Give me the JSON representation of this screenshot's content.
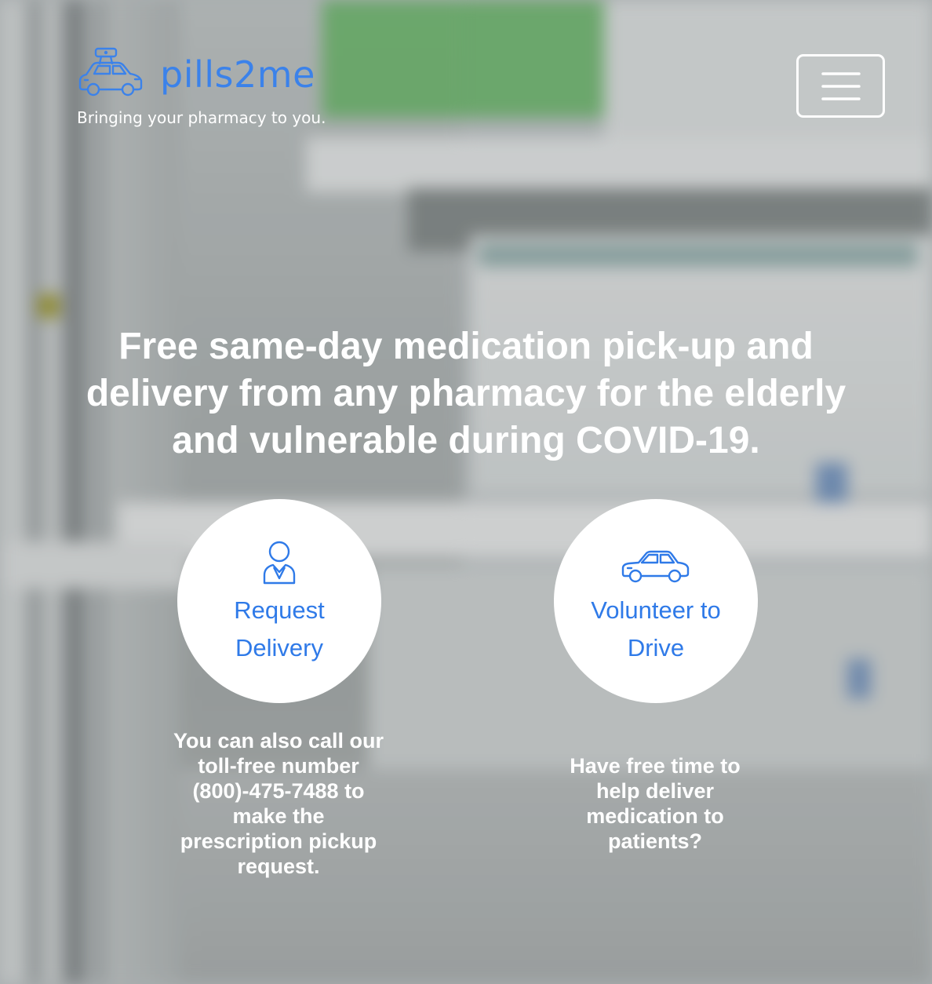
{
  "brand": {
    "name": "pills2me",
    "tagline": "Bringing your pharmacy to you.",
    "logo_icon": "car-icon",
    "color": "#3b82ea"
  },
  "nav": {
    "menu_icon": "hamburger-icon"
  },
  "hero": {
    "headline": "Free same-day medication pick-up and delivery from any pharmacy for the elderly and vulnerable during COVID-19."
  },
  "actions": [
    {
      "label": "Request Delivery",
      "icon": "person-icon",
      "description": "You can also call our toll-free number (800)-475-7488 to make the prescription pickup request."
    },
    {
      "label": "Volunteer to Drive",
      "icon": "car-icon",
      "description": "Have free time to help deliver medication to patients?"
    }
  ],
  "colors": {
    "accent": "#2f7ae8",
    "circle_bg": "#ffffff",
    "text_light": "#ffffff"
  }
}
